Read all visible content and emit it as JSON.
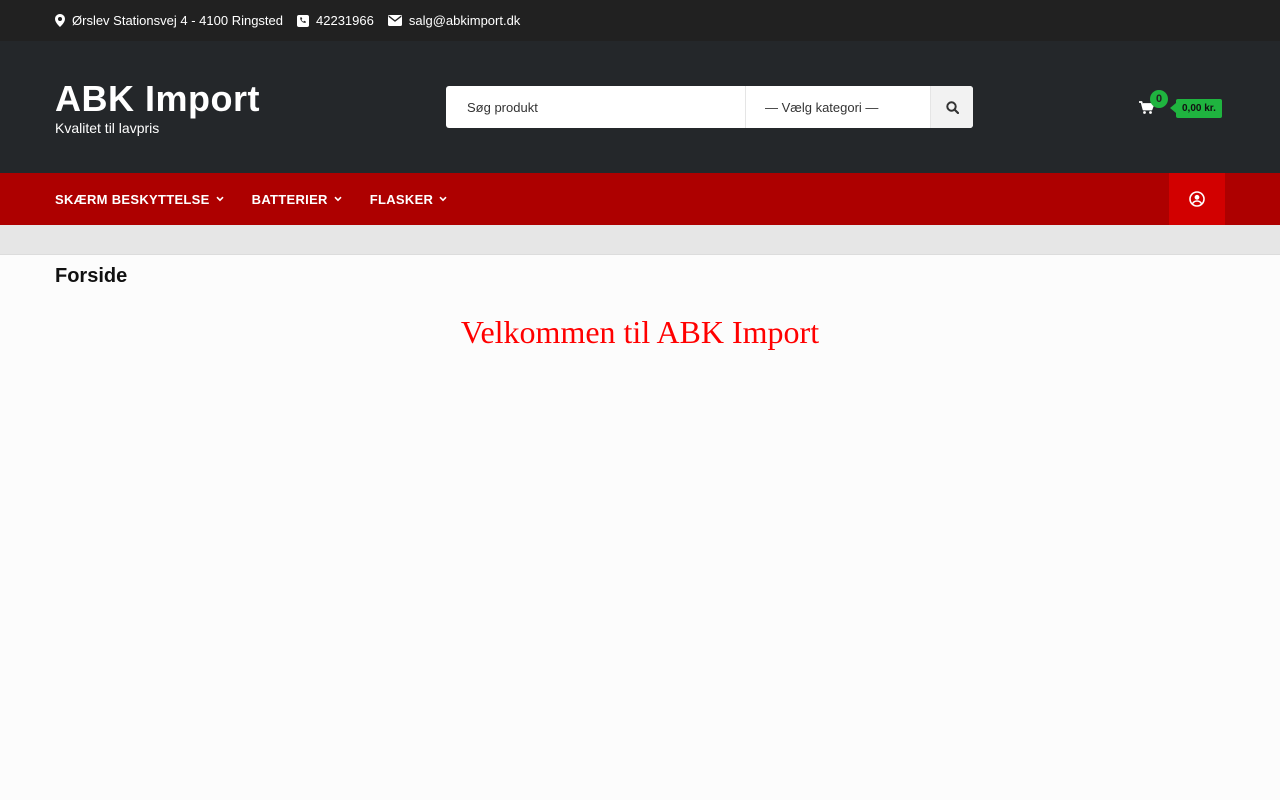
{
  "topbar": {
    "address": "Ørslev Stationsvej 4 - 4100 Ringsted",
    "phone": "42231966",
    "email": "salg@abkimport.dk",
    "icons": [
      "map-marker-icon",
      "phone-icon",
      "envelope-icon"
    ]
  },
  "header": {
    "logo_name": "ABK Import",
    "logo_tagline": "Kvalitet til lavpris",
    "search_placeholder": "Søg produkt",
    "category_select": "— Vælg kategori —",
    "cart_count": "0",
    "cart_total": "0,00 kr."
  },
  "nav": {
    "items": [
      {
        "label": "SKÆRM BESKYTTELSE"
      },
      {
        "label": "BATTERIER"
      },
      {
        "label": "FLASKER"
      }
    ]
  },
  "main": {
    "page_title": "Forside",
    "welcome": "Velkommen til ABK Import"
  },
  "colors": {
    "topbar_bg": "#212121",
    "header_bg": "#24272a",
    "nav_bg": "#ad0000",
    "account_bg": "#d20000",
    "cart_accent": "#1fb43f",
    "welcome_text": "#ff0000"
  }
}
